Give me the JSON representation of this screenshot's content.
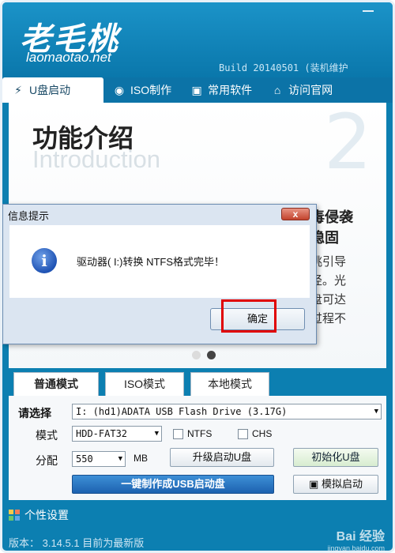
{
  "header": {
    "logo": "老毛桃",
    "site": "laomaotao.net",
    "build": "Build 20140501 (装机维护"
  },
  "tabs": [
    {
      "label": "U盘启动",
      "icon": "usb-icon"
    },
    {
      "label": "ISO制作",
      "icon": "disc-icon"
    },
    {
      "label": "常用软件",
      "icon": "box-icon"
    },
    {
      "label": "访问官网",
      "icon": "home-icon"
    }
  ],
  "content": {
    "title": "功能介绍",
    "title_en": "Introduction",
    "page_number": "2",
    "side_lines": [
      "毒侵袭",
      "稳固",
      "挑引导",
      "径。光",
      "盘可达",
      "过程不"
    ],
    "dots_total": 2,
    "dots_active": 2
  },
  "dialog": {
    "title": "信息提示",
    "close": "x",
    "message": "驱动器( I:)转换 NTFS格式完毕！",
    "ok": "确定"
  },
  "mode_tabs": [
    "普通模式",
    "ISO模式",
    "本地模式"
  ],
  "panel": {
    "select_label": "请选择",
    "drive": "I: (hd1)ADATA USB Flash Drive (3.17G)",
    "mode_label": "模式",
    "mode_value": "HDD-FAT32",
    "ntfs": "NTFS",
    "chs": "CHS",
    "alloc_label": "分配",
    "alloc_value": "550",
    "alloc_unit": "MB",
    "upgrade_button": "升级启动U盘",
    "init_button": "初始化U盘",
    "make_button": "一键制作成USB启动盘",
    "simulate_button": "模拟启动"
  },
  "footer": {
    "settings": "个性设置",
    "version": "版本：  3.14.5.1 目前为最新版",
    "watermark_top": "Bai 经验",
    "watermark_bottom": "jingyan.baidu.com"
  },
  "colors": {
    "brand_blue": "#0c7fb1",
    "highlight_red": "#e00000"
  }
}
